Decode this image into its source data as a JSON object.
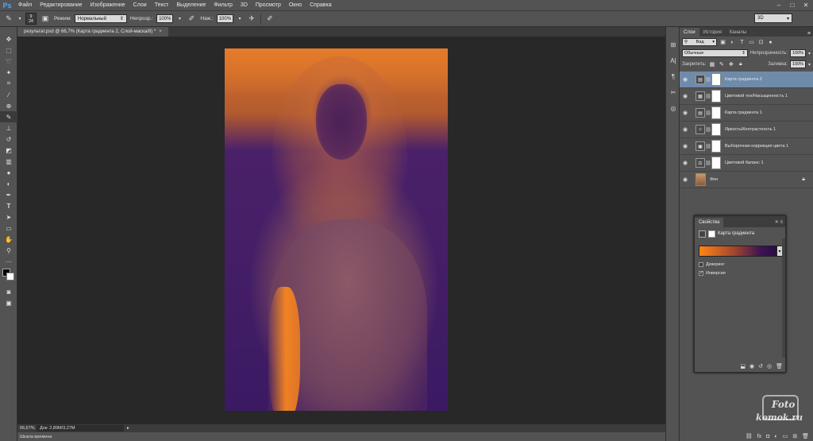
{
  "app": {
    "logo": "Ps"
  },
  "menu": [
    "Файл",
    "Редактирование",
    "Изображение",
    "Слои",
    "Текст",
    "Выделение",
    "Фильтр",
    "3D",
    "Просмотр",
    "Окно",
    "Справка"
  ],
  "options": {
    "brush_size": "24",
    "brush_top": "9",
    "mode_label": "Режим:",
    "mode_value": "Нормальный",
    "opacity_label": "Непрозр.:",
    "opacity_value": "100%",
    "pressure_label": "Наж.:",
    "pressure_value": "100%",
    "workspace": "3D"
  },
  "document": {
    "tab_title": "результат.psd @ 66,7% (Карта градиента 2, Слой-маска/8) *",
    "close": "×"
  },
  "status": {
    "zoom": "66,67%",
    "doc_info": "Док: 2,89M/3,27M",
    "timeline": "Шкала времени"
  },
  "layers_panel": {
    "tabs": [
      "Слои",
      "История",
      "Каналы"
    ],
    "kind_label": "Вид",
    "blend_mode": "Обычные",
    "opacity_label": "Непрозрачность:",
    "opacity_value": "100%",
    "lock_label": "Закрепить:",
    "fill_label": "Заливка:",
    "fill_value": "100%",
    "layers": [
      {
        "name": "Карта градиента 2",
        "icon": "gradient-map-icon",
        "glyph": "▤",
        "selected": true
      },
      {
        "name": "Цветовой тон/Насыщенность 1",
        "icon": "hue-saturation-icon",
        "glyph": "▦",
        "selected": false
      },
      {
        "name": "Карта градиента 1",
        "icon": "gradient-map-icon",
        "glyph": "▤",
        "selected": false
      },
      {
        "name": "Яркость/Контрастность 1",
        "icon": "brightness-icon",
        "glyph": "☼",
        "selected": false
      },
      {
        "name": "Выборочная коррекция цвета 1",
        "icon": "selective-color-icon",
        "glyph": "▣",
        "selected": false
      },
      {
        "name": "Цветовой баланс 1",
        "icon": "color-balance-icon",
        "glyph": "⚖",
        "selected": false
      }
    ],
    "background_layer": "Фон"
  },
  "properties": {
    "tab": "Свойства",
    "title": "Карта градиента",
    "dither_label": "Дизеринг",
    "dither_checked": false,
    "invert_label": "Инверсия",
    "invert_checked": true,
    "gradient_colors": [
      "#ff8514",
      "#a3462f",
      "#3c1551",
      "#2b0c48"
    ]
  },
  "watermark": {
    "line1": "Foto",
    "line2": "komok.ru"
  },
  "colors": {
    "foreground": "#000000",
    "background": "#ffffff",
    "selected_layer": "#6f8baa"
  }
}
